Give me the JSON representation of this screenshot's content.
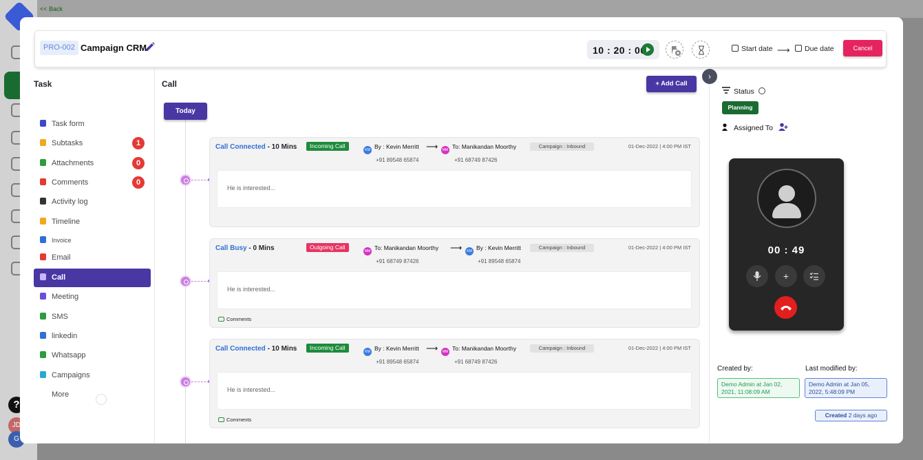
{
  "background": {
    "back_label": "<< Back",
    "avatar1": "JD",
    "avatar2": "G",
    "help": "?"
  },
  "header": {
    "project_id": "PRO-002",
    "project_name": "Campaign CRM",
    "timer": "10 : 20 : 00",
    "start_date_label": "Start date",
    "arrow": "⟶",
    "due_date_label": "Due date",
    "cancel_label": "Cancel"
  },
  "task_panel": {
    "title": "Task",
    "items": [
      {
        "label": "Task form",
        "color": "#3d47c9",
        "badge": ""
      },
      {
        "label": "Subtasks",
        "color": "#f2a81d",
        "badge": "1"
      },
      {
        "label": "Attachments",
        "color": "#2e9b3e",
        "badge": "0"
      },
      {
        "label": "Comments",
        "color": "#e53935",
        "badge": "0"
      },
      {
        "label": "Activity log",
        "color": "#333333",
        "badge": ""
      },
      {
        "label": "Timeline",
        "color": "#f2a81d",
        "badge": ""
      },
      {
        "label": "Invoice",
        "color": "#2f6fd6",
        "badge": ""
      },
      {
        "label": "Email",
        "color": "#e53935",
        "badge": ""
      },
      {
        "label": "Call",
        "color": "#c97ee0",
        "badge": ""
      },
      {
        "label": "Meeting",
        "color": "#6b4fd8",
        "badge": ""
      },
      {
        "label": "SMS",
        "color": "#2e9b3e",
        "badge": ""
      },
      {
        "label": "linkedin",
        "color": "#2f6fd6",
        "badge": ""
      },
      {
        "label": "Whatsapp",
        "color": "#2e9b3e",
        "badge": ""
      },
      {
        "label": "Campaigns",
        "color": "#26a9d6",
        "badge": ""
      },
      {
        "label": "More",
        "color": "",
        "badge": ""
      }
    ],
    "active_item": "Call"
  },
  "call_panel": {
    "title": "Call",
    "add_button": "+ Add Call",
    "group_label": "Today",
    "calls": [
      {
        "status": "Call Connected",
        "duration": " - 10 Mins",
        "type": "Incoming Call",
        "direction": "in",
        "from_prefix": "By : ",
        "from_name": "Kevin Merritt",
        "from_initials": "KM",
        "from_phone": "+91 89548 65874",
        "to_prefix": "To: ",
        "to_name": "Manikandan Moorthy",
        "to_initials": "MM",
        "to_phone": "+91 68749 87426",
        "campaign": "Campaign : Inbound",
        "datetime": "01-Dec-2022 | 4:00 PM IST",
        "note": "He is interested...",
        "comments_label": ""
      },
      {
        "status": "Call Busy",
        "duration": " - 0 Mins",
        "type": "Outgoing Call",
        "direction": "out",
        "from_prefix": "To: ",
        "from_name": "Manikandan Moorthy",
        "from_initials": "MM",
        "from_phone": "+91 68749 87426",
        "to_prefix": "By : ",
        "to_name": "Kevin Merritt",
        "to_initials": "KM",
        "to_phone": "+91 89548 65874",
        "campaign": "Campaign : Inbound",
        "datetime": "01-Dec-2022 | 4:00 PM IST",
        "note": "He is interested...",
        "comments_label": "Comments"
      },
      {
        "status": "Call Connected",
        "duration": " - 10 Mins",
        "type": "Incoming Call",
        "direction": "in",
        "from_prefix": "By : ",
        "from_name": "Kevin Merritt",
        "from_initials": "KM",
        "from_phone": "+91 89548 65874",
        "to_prefix": "To: ",
        "to_name": "Manikandan Moorthy",
        "to_initials": "MM",
        "to_phone": "+91 68749 87426",
        "campaign": "Campaign : Inbound",
        "datetime": "01-Dec-2022 | 4:00 PM IST",
        "note": "He is interested...",
        "comments_label": "Comments"
      }
    ]
  },
  "details_panel": {
    "status_label": "Status",
    "status_value": "Planning",
    "assigned_label": "Assigned To",
    "call_timer": "00 : 49",
    "created_by_label": "Created by:",
    "created_by_value": "Demo Admin at Jan 02, 2021, 11:08:09 AM",
    "modified_by_label": "Last modified by:",
    "modified_by_value": "Demo Admin at Jan 05, 2022, 5:48:09 PM",
    "created_badge_label": "Created",
    "created_badge_value": "2 days ago"
  },
  "colors": {
    "primary": "#4937a3",
    "success": "#1d8b3a",
    "danger": "#e5245f",
    "link": "#2f6fd6"
  }
}
